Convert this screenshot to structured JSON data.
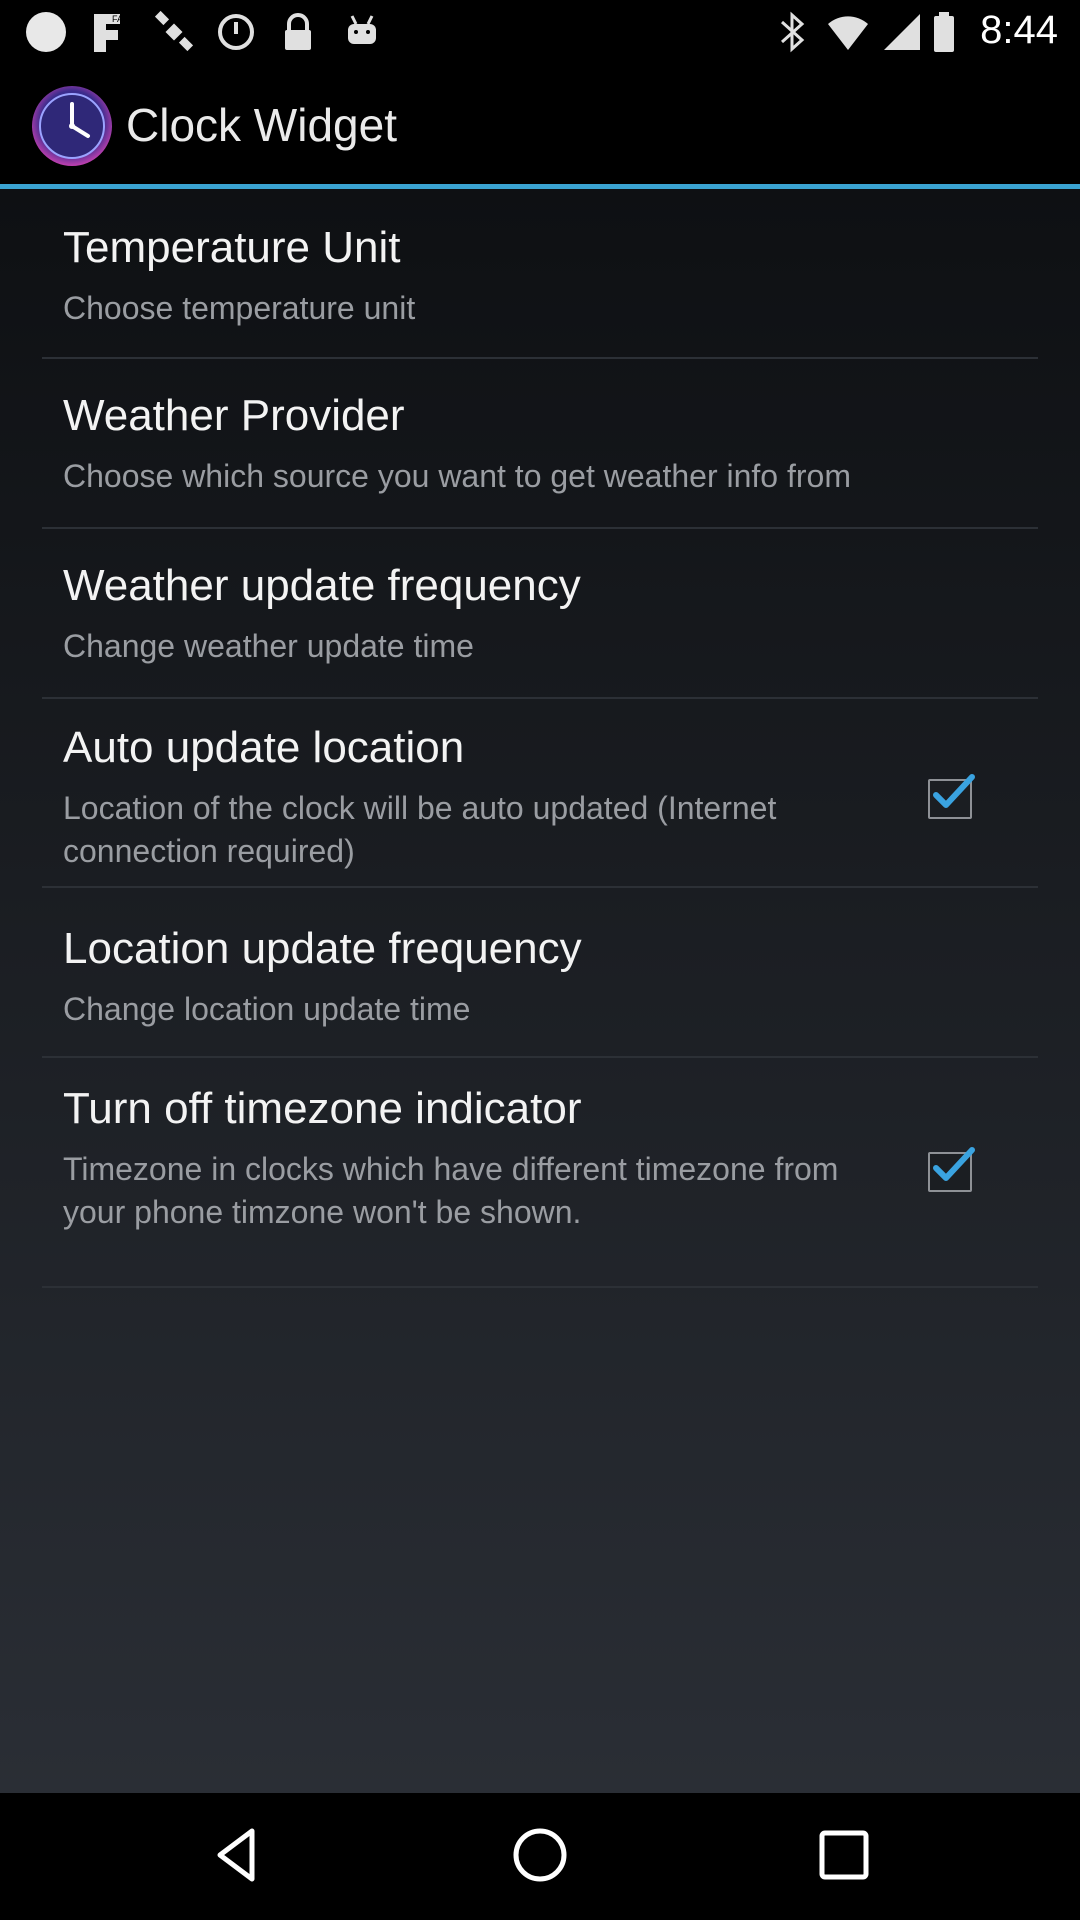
{
  "status_bar": {
    "time": "8:44",
    "left_icons": [
      "circle-icon",
      "fake-gps-icon",
      "satellite-icon",
      "alarm-icon",
      "lock-icon",
      "android-icon"
    ],
    "right_icons": [
      "bluetooth-icon",
      "wifi-icon",
      "signal-icon",
      "battery-icon"
    ]
  },
  "app_bar": {
    "title": "Clock Widget",
    "icon": "clock-icon",
    "accent_color": "#3aa3d1"
  },
  "settings": [
    {
      "title": "Temperature Unit",
      "subtitle": "Choose temperature unit"
    },
    {
      "title": "Weather Provider",
      "subtitle": "Choose which source you want to get weather info from"
    },
    {
      "title": "Weather update frequency",
      "subtitle": "Change weather update time"
    },
    {
      "title": "Auto update location",
      "subtitle": "Location of the clock will be auto updated (Internet connection required)",
      "checked": true
    },
    {
      "title": "Location update frequency",
      "subtitle": "Change location update time"
    },
    {
      "title": "Turn off timezone indicator",
      "subtitle": "Timezone in clocks which have different timezone from your phone timzone won't be shown.",
      "checked": true
    }
  ],
  "nav_bar": {
    "buttons": [
      "back-icon",
      "home-icon",
      "recents-icon"
    ]
  }
}
